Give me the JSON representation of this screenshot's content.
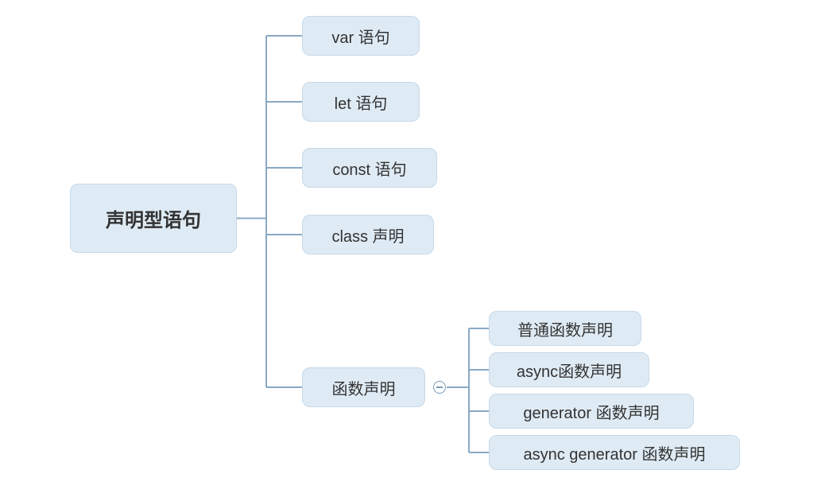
{
  "root": {
    "label": "声明型语句"
  },
  "level1": {
    "var": {
      "label": "var 语句"
    },
    "let": {
      "label": "let 语句"
    },
    "const": {
      "label": "const 语句"
    },
    "class": {
      "label": "class 声明"
    },
    "func": {
      "label": "函数声明"
    }
  },
  "level2": {
    "n0": {
      "label": "普通函数声明"
    },
    "n1": {
      "label": "async函数声明"
    },
    "n2": {
      "label": "generator 函数声明"
    },
    "n3": {
      "label": "async generator 函数声明"
    }
  },
  "colors": {
    "nodeFill": "#dfebf4",
    "nodeBorder": "#c6d8e8",
    "connector": "#8aa8c4",
    "text": "#333333"
  }
}
